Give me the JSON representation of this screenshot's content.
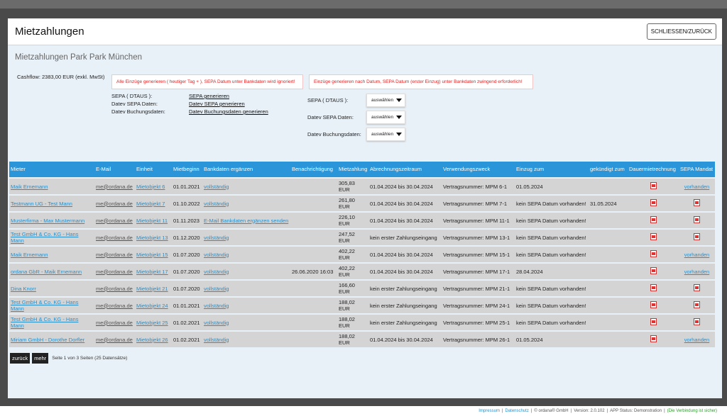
{
  "modal": {
    "title": "Mietzahlungen",
    "close_label": "SCHLIESSEN/ZURÜCK",
    "subtitle": "Mietzahlungen Park Park München",
    "cashflow": "Cashflow: 2383,00 EUR (exkl. MwSt)"
  },
  "alerts": {
    "left": "Alle Einzüge generieren ( heutiger Tag + ), SEPA Datum unter Bankdaten wird ignoriert!",
    "right": "Einzüge generieren nach Datum, SEPA Datum (erster Einzug) unter Bankdaten zwingend erforderlich!"
  },
  "exports": [
    {
      "label": "SEPA ( DTAUS ):",
      "link": "SEPA generieren"
    },
    {
      "label": "Datev SEPA Daten:",
      "link": "Datev SEPA generieren"
    },
    {
      "label": "Datev Buchungsdaten:",
      "link": "Datev Buchungsdaten generieren"
    }
  ],
  "selects": [
    {
      "label": "SEPA ( DTAUS ):",
      "value": "auswählen"
    },
    {
      "label": "Datev SEPA Daten:",
      "value": "auswählen"
    },
    {
      "label": "Datev Buchungsdaten:",
      "value": "auswählen"
    }
  ],
  "table": {
    "headers": [
      "Mieter",
      "E-Mail",
      "Einheit",
      "Mietbeginn",
      "Bankdaten ergänzen",
      "Benachrichtigung",
      "Mietzahlung",
      "Abrechnungszeitraum",
      "Verwendungszweck",
      "Einzug zum",
      "gekündigt zum",
      "Dauermietrechnung",
      "SEPA Mandat"
    ],
    "rows": [
      {
        "mieter": "Maik Ernemann",
        "email": "me@ordana.de",
        "einheit": "Mietobjekt 6",
        "beginn": "01.01.2021",
        "bank": "vollständig",
        "notify": "",
        "zahlung": "305,83  EUR",
        "zeitraum": "01.04.2024 bis 30.04.2024",
        "zweck": "Vertragsnummer: MPM 6-1",
        "einzug": "01.05.2024",
        "kuendigt": "",
        "mandat": "vorhanden"
      },
      {
        "mieter": "Testmann UG - Test Mann",
        "email": "me@ordana.de",
        "einheit": "Mietobjekt 7",
        "beginn": "01.10.2022",
        "bank": "vollständig",
        "notify": "",
        "zahlung": "261,80  EUR",
        "zeitraum": "01.04.2024 bis 30.04.2024",
        "zweck": "Vertragsnummer: MPM 7-1",
        "einzug": "kein SEPA Datum vorhanden!",
        "kuendigt": "31.05.2024",
        "mandat": ""
      },
      {
        "mieter": "Musterfirma - Max Mustermann",
        "email": "me@ordana.de",
        "einheit": "Mietobjekt 11",
        "beginn": "01.11.2023",
        "bank": "E-Mail Bankdaten ergänzen senden",
        "notify": "",
        "zahlung": "226,10  EUR",
        "zeitraum": "01.04.2024 bis 30.04.2024",
        "zweck": "Vertragsnummer: MPM 11-1",
        "einzug": "kein SEPA Datum vorhanden!",
        "kuendigt": "",
        "mandat": ""
      },
      {
        "mieter": "Test GmbH & Co. KG - Hans Mann",
        "email": "me@ordana.de",
        "einheit": "Mietobjekt 13",
        "beginn": "01.12.2020",
        "bank": "vollständig",
        "notify": "",
        "zahlung": "247,52  EUR",
        "zeitraum": "kein erster Zahlungseingang",
        "zweck": "Vertragsnummer: MPM 13-1",
        "einzug": "kein SEPA Datum vorhanden!",
        "kuendigt": "",
        "mandat": ""
      },
      {
        "mieter": "Maik Ernemann",
        "email": "me@ordana.de",
        "einheit": "Mietobjekt 15",
        "beginn": "01.07.2020",
        "bank": "vollständig",
        "notify": "",
        "zahlung": "402,22  EUR",
        "zeitraum": "01.04.2024 bis 30.04.2024",
        "zweck": "Vertragsnummer: MPM 15-1",
        "einzug": "kein SEPA Datum vorhanden!",
        "kuendigt": "",
        "mandat": "vorhanden"
      },
      {
        "mieter": "ordana GbR - Maik Ernemann",
        "email": "me@ordana.de",
        "einheit": "Mietobjekt 17",
        "beginn": "01.07.2020",
        "bank": "vollständig",
        "notify": "26.06.2020 16:03",
        "zahlung": "402,22  EUR",
        "zeitraum": "01.04.2024 bis 30.04.2024",
        "zweck": "Vertragsnummer: MPM 17-1",
        "einzug": "28.04.2024",
        "kuendigt": "",
        "mandat": "vorhanden"
      },
      {
        "mieter": "Dina Knorr",
        "email": "me@ordana.de",
        "einheit": "Mietobjekt 21",
        "beginn": "01.07.2020",
        "bank": "vollständig",
        "notify": "",
        "zahlung": "166,60  EUR",
        "zeitraum": "kein erster Zahlungseingang",
        "zweck": "Vertragsnummer: MPM 21-1",
        "einzug": "kein SEPA Datum vorhanden!",
        "kuendigt": "",
        "mandat": ""
      },
      {
        "mieter": "Test GmbH & Co. KG - Hans Mann",
        "email": "me@ordana.de",
        "einheit": "Mietobjekt 24",
        "beginn": "01.01.2021",
        "bank": "vollständig",
        "notify": "",
        "zahlung": "188,02  EUR",
        "zeitraum": "kein erster Zahlungseingang",
        "zweck": "Vertragsnummer: MPM 24-1",
        "einzug": "kein SEPA Datum vorhanden!",
        "kuendigt": "",
        "mandat": ""
      },
      {
        "mieter": "Test GmbH & Co. KG - Hans Mann",
        "email": "me@ordana.de",
        "einheit": "Mietobjekt 25",
        "beginn": "01.02.2021",
        "bank": "vollständig",
        "notify": "",
        "zahlung": "188,02  EUR",
        "zeitraum": "kein erster Zahlungseingang",
        "zweck": "Vertragsnummer: MPM 25-1",
        "einzug": "kein SEPA Datum vorhanden!",
        "kuendigt": "",
        "mandat": ""
      },
      {
        "mieter": "Miriam GmbH - Dorothe Dorfler",
        "email": "me@ordana.de",
        "einheit": "Mietobjekt 26",
        "beginn": "01.02.2021",
        "bank": "vollständig",
        "notify": "",
        "zahlung": "188,02  EUR",
        "zeitraum": "01.04.2024 bis 30.04.2024",
        "zweck": "Vertragsnummer: MPM 26-1",
        "einzug": "01.05.2024",
        "kuendigt": "",
        "mandat": "vorhanden"
      }
    ],
    "dauer_icon_rows": [
      0,
      1,
      2,
      3,
      4,
      5,
      6,
      7,
      8,
      9
    ],
    "mandat_icon_rows": [
      1,
      2,
      3,
      6,
      7,
      8
    ]
  },
  "pager": {
    "back_label": "zurück",
    "more_label": "mehr",
    "info": "Seite 1 von 3 Seiten (25 Datensätze)"
  },
  "footer": {
    "impressum": "Impressum",
    "datenschutz": "Datenschutz",
    "copyright": "© ordana® GmbH",
    "version": "Version: 2.0.102",
    "app_status": "APP Status: Demonstration",
    "connection": "(Die Verbindung ist sicher)"
  }
}
